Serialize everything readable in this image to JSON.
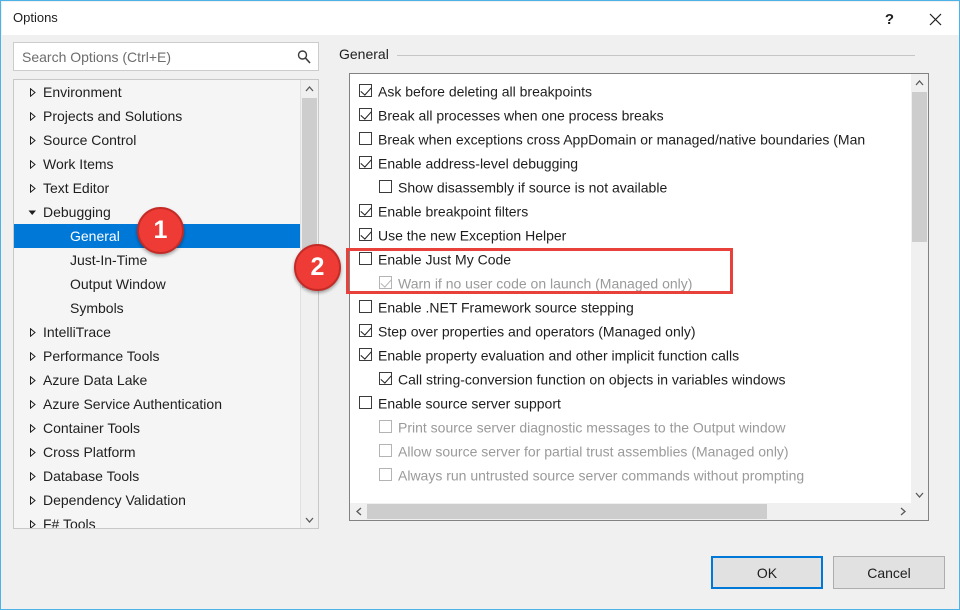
{
  "window": {
    "title": "Options",
    "help_icon": "question-mark-icon",
    "close_icon": "close-icon",
    "accent_color": "#4db2e5"
  },
  "search": {
    "placeholder": "Search Options (Ctrl+E)",
    "value": "",
    "icon": "search-icon"
  },
  "tree": {
    "items": [
      {
        "label": "Environment",
        "level": 0,
        "expandable": true,
        "expanded": false,
        "selected": false
      },
      {
        "label": "Projects and Solutions",
        "level": 0,
        "expandable": true,
        "expanded": false,
        "selected": false
      },
      {
        "label": "Source Control",
        "level": 0,
        "expandable": true,
        "expanded": false,
        "selected": false
      },
      {
        "label": "Work Items",
        "level": 0,
        "expandable": true,
        "expanded": false,
        "selected": false
      },
      {
        "label": "Text Editor",
        "level": 0,
        "expandable": true,
        "expanded": false,
        "selected": false
      },
      {
        "label": "Debugging",
        "level": 0,
        "expandable": true,
        "expanded": true,
        "selected": false
      },
      {
        "label": "General",
        "level": 1,
        "expandable": false,
        "expanded": false,
        "selected": true
      },
      {
        "label": "Just-In-Time",
        "level": 1,
        "expandable": false,
        "expanded": false,
        "selected": false
      },
      {
        "label": "Output Window",
        "level": 1,
        "expandable": false,
        "expanded": false,
        "selected": false
      },
      {
        "label": "Symbols",
        "level": 1,
        "expandable": false,
        "expanded": false,
        "selected": false
      },
      {
        "label": "IntelliTrace",
        "level": 0,
        "expandable": true,
        "expanded": false,
        "selected": false
      },
      {
        "label": "Performance Tools",
        "level": 0,
        "expandable": true,
        "expanded": false,
        "selected": false
      },
      {
        "label": "Azure Data Lake",
        "level": 0,
        "expandable": true,
        "expanded": false,
        "selected": false
      },
      {
        "label": "Azure Service Authentication",
        "level": 0,
        "expandable": true,
        "expanded": false,
        "selected": false
      },
      {
        "label": "Container Tools",
        "level": 0,
        "expandable": true,
        "expanded": false,
        "selected": false
      },
      {
        "label": "Cross Platform",
        "level": 0,
        "expandable": true,
        "expanded": false,
        "selected": false
      },
      {
        "label": "Database Tools",
        "level": 0,
        "expandable": true,
        "expanded": false,
        "selected": false
      },
      {
        "label": "Dependency Validation",
        "level": 0,
        "expandable": true,
        "expanded": false,
        "selected": false
      },
      {
        "label": "F# Tools",
        "level": 0,
        "expandable": true,
        "expanded": false,
        "selected": false
      }
    ],
    "selection_color": "#0078d7"
  },
  "section": {
    "title": "General"
  },
  "options": [
    {
      "label": "Ask before deleting all breakpoints",
      "checked": true,
      "indent": 0,
      "disabled": false
    },
    {
      "label": "Break all processes when one process breaks",
      "checked": true,
      "indent": 0,
      "disabled": false
    },
    {
      "label": "Break when exceptions cross AppDomain or managed/native boundaries (Man",
      "checked": false,
      "indent": 0,
      "disabled": false
    },
    {
      "label": "Enable address-level debugging",
      "checked": true,
      "indent": 0,
      "disabled": false
    },
    {
      "label": "Show disassembly if source is not available",
      "checked": false,
      "indent": 1,
      "disabled": false
    },
    {
      "label": "Enable breakpoint filters",
      "checked": true,
      "indent": 0,
      "disabled": false
    },
    {
      "label": "Use the new Exception Helper",
      "checked": true,
      "indent": 0,
      "disabled": false
    },
    {
      "label": "Enable Just My Code",
      "checked": false,
      "indent": 0,
      "disabled": false
    },
    {
      "label": "Warn if no user code on launch (Managed only)",
      "checked": true,
      "indent": 1,
      "disabled": true
    },
    {
      "label": "Enable .NET Framework source stepping",
      "checked": false,
      "indent": 0,
      "disabled": false
    },
    {
      "label": "Step over properties and operators (Managed only)",
      "checked": true,
      "indent": 0,
      "disabled": false
    },
    {
      "label": "Enable property evaluation and other implicit function calls",
      "checked": true,
      "indent": 0,
      "disabled": false
    },
    {
      "label": "Call string-conversion function on objects in variables windows",
      "checked": true,
      "indent": 1,
      "disabled": false
    },
    {
      "label": "Enable source server support",
      "checked": false,
      "indent": 0,
      "disabled": false
    },
    {
      "label": "Print source server diagnostic messages to the Output window",
      "checked": false,
      "indent": 1,
      "disabled": true
    },
    {
      "label": "Allow source server for partial trust assemblies (Managed only)",
      "checked": false,
      "indent": 1,
      "disabled": true
    },
    {
      "label": "Always run untrusted source server commands without prompting",
      "checked": false,
      "indent": 1,
      "disabled": true
    }
  ],
  "highlight": {
    "color": "#e8403a"
  },
  "callouts": [
    {
      "number": "1"
    },
    {
      "number": "2"
    }
  ],
  "footer": {
    "ok_label": "OK",
    "cancel_label": "Cancel"
  }
}
